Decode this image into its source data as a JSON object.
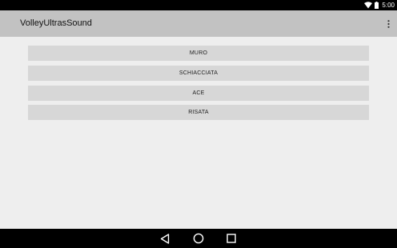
{
  "status_bar": {
    "time": "5:00",
    "icons": [
      "wifi-icon",
      "battery-icon"
    ]
  },
  "action_bar": {
    "title": "VolleyUltrasSound",
    "overflow_icon": "more-vert-icon"
  },
  "buttons": [
    {
      "label": "MURO"
    },
    {
      "label": "SCHIACCIATA"
    },
    {
      "label": "ACE"
    },
    {
      "label": "RISATA"
    }
  ],
  "nav_bar": {
    "icons": [
      "back-icon",
      "home-icon",
      "recents-icon"
    ]
  },
  "colors": {
    "status_bar": "#000000",
    "action_bar": "#c2c2c2",
    "background": "#eeeeee",
    "button": "#d7d7d7",
    "nav_bar": "#000000"
  }
}
